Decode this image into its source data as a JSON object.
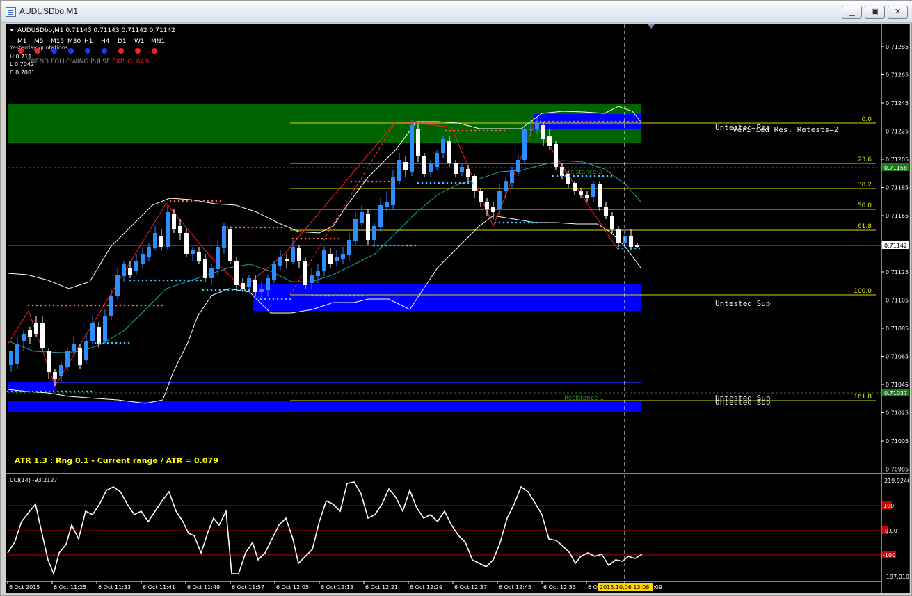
{
  "window": {
    "title": "AUDUSDbo,M1",
    "icon": "chart-window-icon",
    "buttons": [
      {
        "name": "minimize-button",
        "glyph": "▁"
      },
      {
        "name": "restore-button",
        "glyph": "▣"
      },
      {
        "name": "close-button",
        "glyph": "✕"
      }
    ]
  },
  "chart": {
    "symbol_line": "AUDUSDbo,M1  0.71143 0.71143 0.71142 0.71142",
    "timeframes": [
      "M1",
      "M5",
      "M15",
      "M30",
      "H1",
      "H4",
      "D1",
      "W1",
      "MN1"
    ],
    "timeframe_dot_colors": [
      "#ff1f1f",
      "#ff1f1f",
      "#2134ff",
      "#2134ff",
      "#2134ff",
      "#2134ff",
      "#ff1f1f",
      "#ff1f1f",
      "#ff1f1f"
    ],
    "yesterday": {
      "heading": "Yesterday quotations:",
      "high": "H 0.711",
      "low": "L 0.7042",
      "close": "C 0.7081"
    },
    "trend_label": "TREND FOLLOWING PULSE",
    "explo_label": "EXPLO: 64%",
    "atr_text": "ATR 1.3 : Rng 0.1 - Current range / ATR = 0.079",
    "price_axis": [
      "0.71285",
      "0.71265",
      "0.71245",
      "0.71225",
      "0.71205",
      "0.71185",
      "0.71165",
      "0.71145",
      "0.71125",
      "0.71105",
      "0.71085",
      "0.71065",
      "0.71045",
      "0.71025",
      "0.71005",
      "0.70985"
    ],
    "current_price_tag": "0.71142",
    "pivot_tag_top": "0.71158",
    "pivot_tag_bottom": "0.71037",
    "fib_levels": [
      "0.0",
      "23.6",
      "38.2",
      "50.0",
      "61.8",
      "100.0",
      "161.8"
    ],
    "zone_labels": {
      "top_overlap_a": "Untested Res",
      "top_overlap_b": "Verified Res, Retests=2",
      "mid": "Untested Sup",
      "bottom_a": "Untested Sup",
      "bottom_b": "Untested Sup"
    },
    "resistance_labels": [
      "Resistance 2",
      "Resistance 1"
    ],
    "time_axis": [
      "6 Oct 2015",
      "6 Oct 11:25",
      "6 Oct 11:33",
      "6 Oct 11:41",
      "6 Oct 11:49",
      "6 Oct 11:57",
      "6 Oct 12:05",
      "6 Oct 12:13",
      "6 Oct 12:21",
      "6 Oct 12:29",
      "6 Oct 12:37",
      "6 Oct 12:45",
      "6 Oct 12:53",
      "6 Oct",
      "2015.10.06 13:08",
      ":09"
    ],
    "colors": {
      "bull_candle": "#2d8cff",
      "bear_candle": "#ffffff",
      "supply_zone": "#006400",
      "demand_zone": "#0000ff",
      "fib_line": "#e6e600",
      "text_yellow": "#ffff00",
      "explo_red": "#ff1f1f"
    }
  },
  "cci": {
    "title": "CCI(14) -93.2127",
    "axis_top": "219.9246",
    "axis_bottom": "-197.0107",
    "level_labels": [
      "100",
      "0.00",
      "-100"
    ]
  }
}
